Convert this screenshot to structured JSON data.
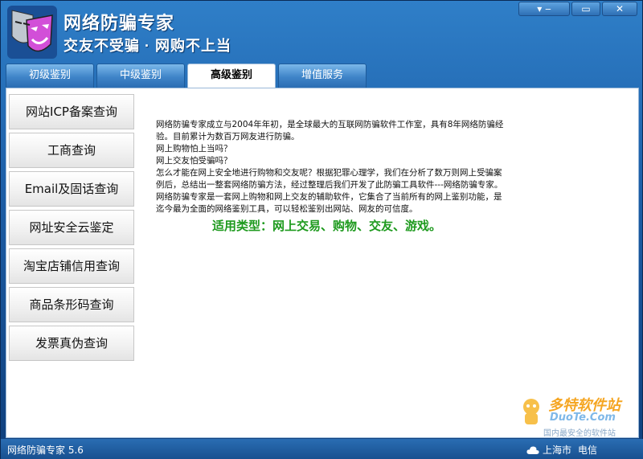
{
  "header": {
    "title": "网络防骗专家",
    "slogan": "交友不受骗 · 网购不上当"
  },
  "window_controls": {
    "min": "▾ ‒",
    "max": "▭",
    "close": "✕"
  },
  "tabs": [
    {
      "label": "初级鉴别",
      "active": false
    },
    {
      "label": "中级鉴别",
      "active": false
    },
    {
      "label": "高级鉴别",
      "active": true
    },
    {
      "label": "增值服务",
      "active": false
    }
  ],
  "sidebar": {
    "items": [
      {
        "label": "网站ICP备案查询"
      },
      {
        "label": "工商查询"
      },
      {
        "label": "Email及固话查询"
      },
      {
        "label": "网址安全云鉴定"
      },
      {
        "label": "淘宝店铺信用查询"
      },
      {
        "label": "商品条形码查询"
      },
      {
        "label": "发票真伪查询"
      }
    ]
  },
  "content": {
    "paragraph1": "网络防骗专家成立与2004年年初，是全球最大的互联网防骗软件工作室，具有8年网络防骗经验。目前累计为数百万网友进行防骗。",
    "line2": "网上购物怕上当吗？",
    "line3": "网上交友怕受骗吗？",
    "paragraph4": "怎么才能在网上安全地进行购物和交友呢？根据犯罪心理学，我们在分析了数万则网上受骗案例后，总结出一整套网络防骗方法，经过整理后我们开发了此防骗工具软件---网络防骗专家。",
    "paragraph5": "网络防骗专家是一套网上购物和网上交友的辅助软件，它集合了当前所有的网上鉴别功能，是迄今最为全面的网络鉴别工具，可以轻松鉴别出网站、网友的可信度。",
    "usage": "适用类型：网上交易、购物、交友、游戏。"
  },
  "watermark": {
    "brand": "多特软件站",
    "site": "DuoTe.Com",
    "sub": "国内最安全的软件站"
  },
  "status": {
    "version": "网络防骗专家 5.6",
    "location": "上海市",
    "isp": "电信"
  },
  "colors": {
    "accent_blue": "#1d5fa8",
    "usage_green": "#1e9a1e"
  }
}
